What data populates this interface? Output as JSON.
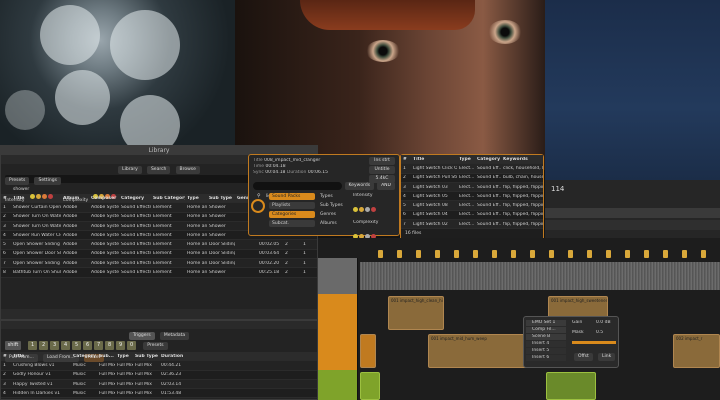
{
  "library": {
    "window_title": "Library",
    "toolbar": [
      "Library",
      "Search",
      "Browse"
    ],
    "presets_label": "Presets",
    "settings_label": "Settings",
    "search_value": "shower",
    "intensity_label": "Intensity",
    "complexity_label": "Complexity",
    "columns": [
      "#",
      "Title",
      "Album",
      "Composer",
      "Category",
      "Sub Category",
      "Type",
      "Sub Type",
      "Genre",
      "",
      "",
      ""
    ],
    "rows": [
      [
        "1",
        "Shower Curtain Open 01",
        "Adobe",
        "Adobe Syste...",
        "Sound Effects",
        "Element",
        "Home an...",
        "Shower",
        "",
        "00:04.71",
        "2",
        "1"
      ],
      [
        "2",
        "Shower Turn On Water ...",
        "Adobe",
        "Adobe Syste...",
        "Sound Effects",
        "Element",
        "Home an...",
        "Shower",
        "",
        "00:19.23",
        "2",
        "1"
      ],
      [
        "3",
        "Shower Turn On Water ...",
        "Adobe",
        "Adobe Syste...",
        "Sound Effects",
        "Element",
        "Home an...",
        "Shower",
        "",
        "00:22.77",
        "2",
        "1"
      ],
      [
        "4",
        "Shower Run Water Clos...",
        "Adobe",
        "Adobe Syste...",
        "Sound Effects",
        "Element",
        "Home an...",
        "Shower",
        "",
        "00:20.13",
        "2",
        "1"
      ],
      [
        "5",
        "Open Shower Sliding Gl...",
        "Adobe",
        "Adobe Syste...",
        "Sound Effects",
        "Element",
        "Home an...",
        "Door Sliding",
        "",
        "00:02.05",
        "2",
        "1"
      ],
      [
        "6",
        "Open Shower Door Slid...",
        "Adobe",
        "Adobe Syste...",
        "Sound Effects",
        "Element",
        "Home an...",
        "Door Sliding",
        "",
        "00:03.64",
        "2",
        "1"
      ],
      [
        "7",
        "Open Shower Sliding Gl...",
        "Adobe",
        "Adobe Syste...",
        "Sound Effects",
        "Element",
        "Home an...",
        "Door Sliding",
        "",
        "00:02.20",
        "2",
        "1"
      ],
      [
        "8",
        "Bathtub Turn On Shul...",
        "Adobe",
        "Adobe Syste...",
        "Sound Effects",
        "Element",
        "Home an...",
        "Shower",
        "",
        "00:25.18",
        "2",
        "1"
      ]
    ],
    "files_count": "8 files",
    "options_label": "Options",
    "triggers_label": "Triggers"
  },
  "triggers": {
    "tabs": [
      "Triggers",
      "Metadata"
    ],
    "shift_label": "shift",
    "keys": [
      "1",
      "2",
      "3",
      "4",
      "5",
      "6",
      "7",
      "8",
      "9",
      "0"
    ],
    "presets_label": "Presets",
    "pull_from_label": "Pull From...",
    "load_from_label": "Load From...",
    "reset_label": "Reset",
    "columns": [
      "#",
      "Title",
      "Category",
      "Sub...",
      "Type",
      "Sub Type",
      "Duration"
    ],
    "rows": [
      [
        "1",
        "Crushing Blows v1",
        "Music",
        "Full Mix",
        "Full Mix",
        "Full Mix",
        "00:44.21"
      ],
      [
        "2",
        "Godly Honour v1",
        "Music",
        "Full Mix",
        "Full Mix",
        "Full Mix",
        "02:36.23"
      ],
      [
        "3",
        "Happy Twisted v1",
        "Music",
        "Full Mix",
        "Full Mix",
        "Full Mix",
        "02:03.14"
      ],
      [
        "4",
        "Hidden In Darkies v1",
        "Music",
        "Full Mix",
        "Full Mix",
        "Full Mix",
        "01:53.48"
      ]
    ]
  },
  "inspector": {
    "title_label": "Title",
    "title_value": "008_impact_mid_clanger",
    "time_label": "Time",
    "time_value": "00:04.18",
    "sync_label": "Sync",
    "sync_value": "00:04.18",
    "duration_label": "Duration",
    "duration_value": "00:06.15",
    "buttons_right": [
      "Ins strt",
      "Untitle",
      "5.4kC"
    ],
    "search_value": "light switch.",
    "keywords_label": "Keywords",
    "and_label": "AND",
    "filters": [
      "Sound Packs",
      "Types",
      "Intensity",
      "Playlists",
      "Sub Types",
      "Complexity",
      "Categories",
      "Genres",
      "Duration",
      "Subcat.",
      "Albums"
    ]
  },
  "results": {
    "columns": [
      "#",
      "Title",
      "Type",
      "Category",
      "Keywords"
    ],
    "rows": [
      [
        "1",
        "Light Switch Click Off",
        "Elect...",
        "Sound Eff...",
        "click, household, light"
      ],
      [
        "2",
        "Light Switch Pull String",
        "Elect...",
        "Sound Eff...",
        "bulb, chain, household"
      ],
      [
        "3",
        "Light Switch 03",
        "Elect...",
        "Sound Eff...",
        "flip, flipped, flipping,..."
      ],
      [
        "4",
        "Light Switch 05",
        "Elect...",
        "Sound Eff...",
        "flip, flipped, flipping,..."
      ],
      [
        "5",
        "Light Switch 08",
        "Elect...",
        "Sound Eff...",
        "flip, flipped, flipping,..."
      ],
      [
        "6",
        "Light Switch 04",
        "Elect...",
        "Sound Eff...",
        "flip, flipped, flipping,..."
      ],
      [
        "7",
        "Light Switch 02",
        "Elect...",
        "Sound Eff...",
        "flip, flipped, flipping,..."
      ]
    ],
    "files_count": "16 files"
  },
  "daw": {
    "counter": "114",
    "clips": [
      "001 impact_high_clean_high",
      "001 impact_high_sweetener",
      "001 impact_mid_hum_weep",
      "002 impact_r"
    ],
    "popup": {
      "items": [
        "EMO Set 1",
        "Comp Fil...",
        "Scene B",
        "Insert 4",
        "Insert 5",
        "Insert 6"
      ],
      "knobs": [
        "Gain",
        "Mask"
      ],
      "values": [
        "0.0 dB",
        "0.5"
      ],
      "buttons": [
        "Offst",
        "Link"
      ]
    }
  },
  "colors": {
    "accent": "#c07a20",
    "clip": "#8a6a3a",
    "track_orange": "#d98a1c",
    "track_green": "#7fa32a"
  }
}
